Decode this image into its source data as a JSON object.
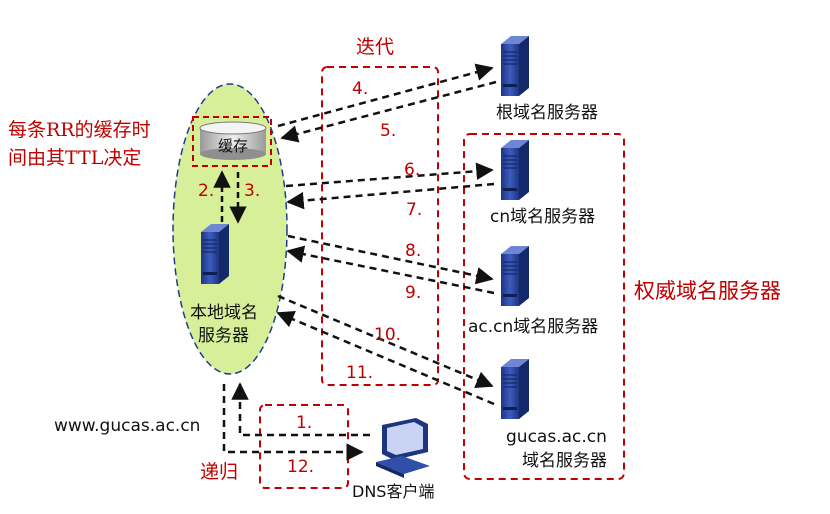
{
  "colors": {
    "accent_red": "#c00000",
    "server_blue": "#2f4fa8",
    "ellipse_fill": "#d8ef9a",
    "arrow": "#111111"
  },
  "annotations": {
    "ttl_line1": "每条RR的缓存时",
    "ttl_line2": "间由其TTL决定",
    "iterative": "迭代",
    "recursive": "递归",
    "authoritative": "权威域名服务器",
    "query_domain": "www.gucas.ac.cn"
  },
  "local_server": {
    "cache": "缓存",
    "name_line1": "本地域名",
    "name_line2": "服务器"
  },
  "servers": {
    "root": "根域名服务器",
    "cn": "cn域名服务器",
    "ac_cn": "ac.cn域名服务器",
    "gucas_line1": "gucas.ac.cn",
    "gucas_line2": "域名服务器"
  },
  "client": "DNS客户端",
  "steps": {
    "s1": "1.",
    "s2": "2.",
    "s3": "3.",
    "s4": "4.",
    "s5": "5.",
    "s6": "6.",
    "s7": "7.",
    "s8": "8.",
    "s9": "9.",
    "s10": "10.",
    "s11": "11.",
    "s12": "12."
  },
  "icons": [
    "server-icon",
    "computer-icon",
    "cache-cylinder-icon"
  ]
}
